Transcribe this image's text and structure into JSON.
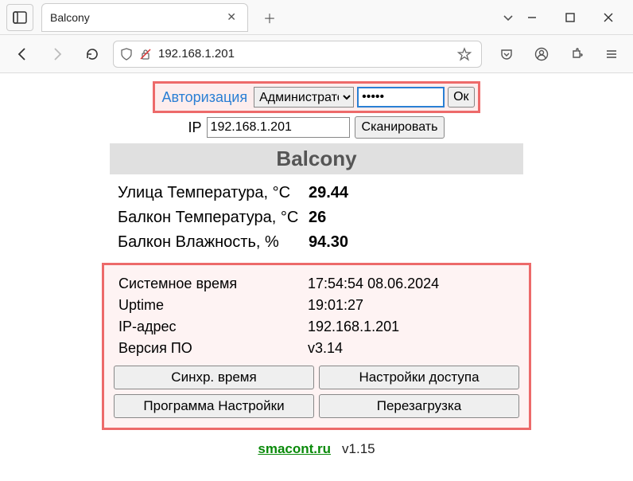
{
  "browser": {
    "tab_title": "Balcony",
    "url": "192.168.1.201"
  },
  "auth": {
    "label": "Авторизация",
    "role": "Администратор",
    "password_display": "●●●●●",
    "ok_label": "Ок"
  },
  "ip": {
    "label": "IP",
    "value": "192.168.1.201",
    "scan_label": "Сканировать"
  },
  "device_title": "Balcony",
  "sensors": [
    {
      "label": "Улица Температура, °C",
      "value": "29.44"
    },
    {
      "label": "Балкон Температура, °C",
      "value": "26"
    },
    {
      "label": "Балкон Влажность, %",
      "value": "94.30"
    }
  ],
  "system": {
    "rows": [
      {
        "label": "Системное время",
        "value": "17:54:54    08.06.2024"
      },
      {
        "label": "Uptime",
        "value": "19:01:27"
      },
      {
        "label": "IP-адрес",
        "value": "192.168.1.201"
      },
      {
        "label": "Версия ПО",
        "value": "v3.14"
      }
    ],
    "buttons": {
      "sync_time": "Синхр. время",
      "access_settings": "Настройки доступа",
      "program_settings": "Программа Настройки",
      "reboot": "Перезагрузка"
    }
  },
  "footer": {
    "link": "smacont.ru",
    "version": "v1.15"
  }
}
